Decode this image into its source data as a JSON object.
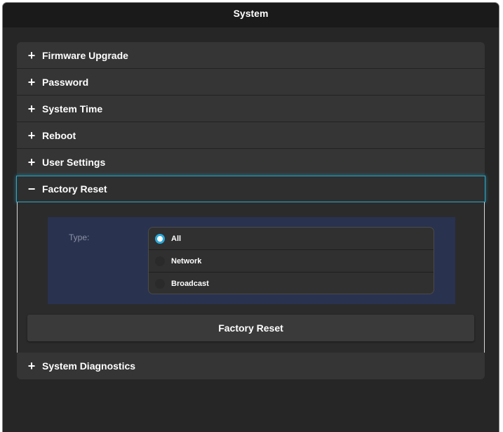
{
  "window": {
    "title": "System"
  },
  "sections": [
    {
      "label": "Firmware Upgrade",
      "icon": "plus-icon",
      "expanded": false
    },
    {
      "label": "Password",
      "icon": "plus-icon",
      "expanded": false
    },
    {
      "label": "System Time",
      "icon": "plus-icon",
      "expanded": false
    },
    {
      "label": "Reboot",
      "icon": "plus-icon",
      "expanded": false
    },
    {
      "label": "User Settings",
      "icon": "plus-icon",
      "expanded": false
    },
    {
      "label": "Factory Reset",
      "icon": "minus-icon",
      "expanded": true
    },
    {
      "label": "System Diagnostics",
      "icon": "plus-icon",
      "expanded": false
    }
  ],
  "factory_reset": {
    "type_label": "Type:",
    "options": [
      {
        "label": "All",
        "selected": true
      },
      {
        "label": "Network",
        "selected": false
      },
      {
        "label": "Broadcast",
        "selected": false
      }
    ],
    "button_label": "Factory Reset"
  },
  "colors": {
    "accent": "#2aa9c9",
    "radio_selected": "#2ba8d8",
    "panel_bg": "#29324f",
    "window_bg": "#262626",
    "titlebar_bg": "#1a1a1a"
  },
  "glyphs": {
    "plus": "+",
    "minus": "−"
  }
}
